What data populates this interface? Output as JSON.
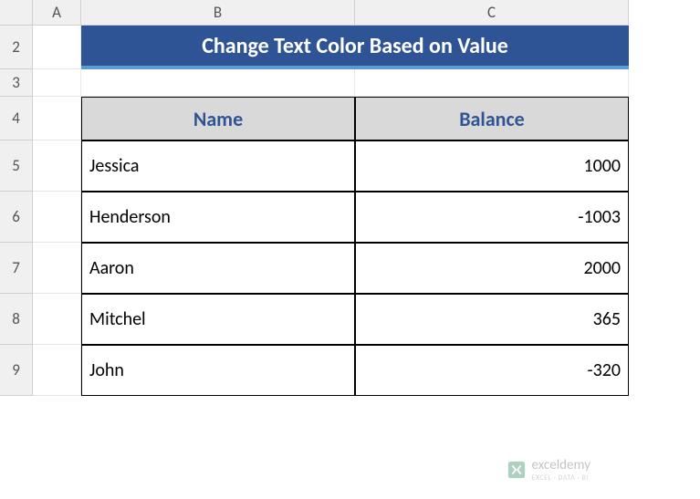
{
  "columns": [
    "A",
    "B",
    "C"
  ],
  "rows": [
    "2",
    "3",
    "4",
    "5",
    "6",
    "7",
    "8",
    "9"
  ],
  "title": "Change Text Color Based on Value",
  "headers": {
    "name": "Name",
    "balance": "Balance"
  },
  "data": [
    {
      "name": "Jessica",
      "balance": "1000"
    },
    {
      "name": "Henderson",
      "balance": "-1003"
    },
    {
      "name": "Aaron",
      "balance": "2000"
    },
    {
      "name": "Mitchel",
      "balance": "365"
    },
    {
      "name": "John",
      "balance": "-320"
    }
  ],
  "watermark": {
    "brand": "exceldemy",
    "tagline": "EXCEL · DATA · BI"
  },
  "chart_data": {
    "type": "table",
    "title": "Change Text Color Based on Value",
    "columns": [
      "Name",
      "Balance"
    ],
    "rows": [
      [
        "Jessica",
        1000
      ],
      [
        "Henderson",
        -1003
      ],
      [
        "Aaron",
        2000
      ],
      [
        "Mitchel",
        365
      ],
      [
        "John",
        -320
      ]
    ]
  }
}
